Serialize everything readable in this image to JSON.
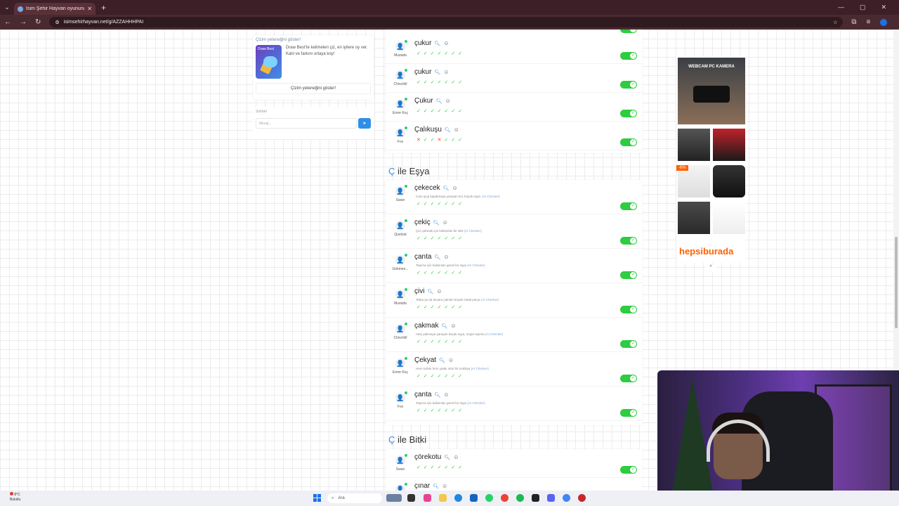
{
  "browser": {
    "tab_title": "İsim Şehir Hayvan oyununa katı",
    "url": "isimsehirhayvan.net/g/AZZAHHHPAI"
  },
  "left": {
    "draw_title": "Çizim yeteneğini göster!",
    "draw_img_label": "Draw Best",
    "draw_desc": "Draw Best'te kelimeleri çiz, en iyilere oy ver. Katıl ve farkını ortaya koy!",
    "draw_button": "Çizim yeteneğini göster!",
    "chat_title": "Sohbet",
    "chat_placeholder": "Mesaj..."
  },
  "prev_rows": [
    {
      "word": "çukur",
      "user": "Mustafa",
      "votes": [
        "ok",
        "ok",
        "ok",
        "ok",
        "ok",
        "ok",
        "ok"
      ]
    },
    {
      "word": "çukur",
      "user": "Chinchill",
      "votes": [
        "ok",
        "ok",
        "ok",
        "ok",
        "ok",
        "ok",
        "ok"
      ]
    },
    {
      "word": "Çukur",
      "user": "Emre Koç",
      "votes": [
        "ok",
        "ok",
        "ok",
        "ok",
        "ok",
        "ok",
        "ok"
      ]
    },
    {
      "word": "Çalıkuşu",
      "user": "Fox",
      "votes": [
        "bad",
        "ok",
        "ok",
        "bad",
        "ok",
        "ok",
        "ok"
      ]
    }
  ],
  "esya": {
    "letter": "Ç",
    "title": "ile Eşya",
    "rows": [
      {
        "word": "çekecek",
        "user": "Swan",
        "desc": "Cam açıp kapatmaya yarayan kol, küçük eşya.",
        "ai": "(AI Checker)"
      },
      {
        "word": "çekiç",
        "user": "Quetzal",
        "desc": "Çivi çakmak için kullanılan bir alet",
        "ai": "(AI Checker)"
      },
      {
        "word": "çanta",
        "user": "Gokmen...",
        "desc": "Taşıma için kullanılan genel bir eşya",
        "ai": "(AI Checker)"
      },
      {
        "word": "çivi",
        "user": "Mustafa",
        "desc": "Tahta ya da duvara çakılan küçük metal parça",
        "ai": "(AI Checker)"
      },
      {
        "word": "çakmak",
        "user": "Chinchill",
        "desc": "Ateş yakmaya yarayan küçük eşya, özgür taşıma",
        "ai": "(AI Checker)"
      },
      {
        "word": "Çekyat",
        "user": "Emre Koç",
        "desc": "Hem koltuk hem yatak olan bir mobilya",
        "ai": "(AI Checker)"
      },
      {
        "word": "çanta",
        "user": "Fox",
        "desc": "Taşıma için kullanılan genel bir eşya",
        "ai": "(AI Checker)"
      }
    ]
  },
  "bitki": {
    "letter": "Ç",
    "title": "ile Bitki",
    "rows": [
      {
        "word": "çörekotu",
        "user": "Swan"
      },
      {
        "word": "çınar",
        "user": ""
      }
    ]
  },
  "ad": {
    "webcam_text": "WEBCAM PC KAMERA",
    "discount": "-6%",
    "brand": "hepsiburada",
    "collapse": "^"
  },
  "taskbar": {
    "temp": "8°C",
    "cond": "Bulutlu",
    "search": "Ara"
  },
  "colors": {
    "accent": "#3a8ee6",
    "ok": "#2ecc40",
    "bad": "#e74c3c",
    "brand": "#ff6000"
  }
}
